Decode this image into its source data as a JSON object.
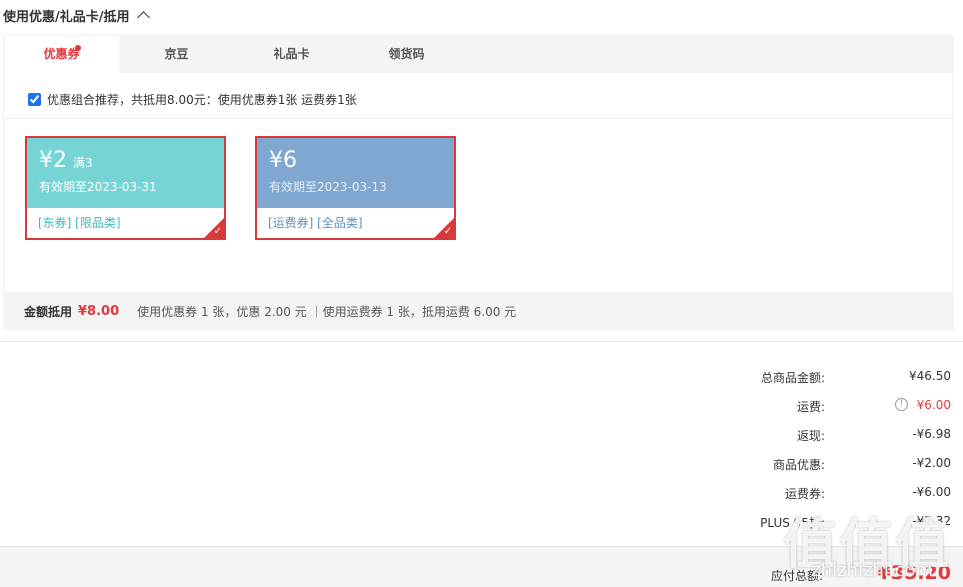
{
  "section": {
    "title": "使用优惠/礼品卡/抵用"
  },
  "tabs": [
    {
      "label": "优惠券",
      "active": true
    },
    {
      "label": "京豆"
    },
    {
      "label": "礼品卡"
    },
    {
      "label": "领货码"
    }
  ],
  "combo": {
    "text": "优惠组合推荐，共抵用8.00元：使用优惠券1张 运费券1张",
    "checked": true
  },
  "coupons": [
    {
      "amount": "¥2",
      "condition": "满3",
      "validity": "有效期至2023-03-31",
      "tags": "[东券]  [限品类]",
      "selected_mark": "✓"
    },
    {
      "amount": "¥6",
      "condition": "",
      "validity": "有效期至2023-03-13",
      "tags": "[运费券]  [全品类]",
      "selected_mark": "✓"
    }
  ],
  "summary": {
    "label": "金额抵用",
    "amount": "¥8.00",
    "detail": "使用优惠券 1 张，优惠 2.00 元 ｜使用运费券 1 张，抵用运费 6.00 元"
  },
  "totals": [
    {
      "label": "总商品金额:",
      "value": "¥46.50"
    },
    {
      "label": "运费:",
      "value": "¥6.00",
      "info_icon": "info-circle-icon"
    },
    {
      "label": "返现:",
      "value": "-¥6.98"
    },
    {
      "label": "商品优惠:",
      "value": "-¥2.00"
    },
    {
      "label": "运费券:",
      "value": "-¥6.00"
    },
    {
      "label": "PLUS 95折:",
      "value": "-¥2.32"
    }
  ],
  "footer": {
    "label": "应付总额:",
    "value": "¥35.20"
  },
  "watermark": {
    "glyphs": "值值值",
    "text": "zhizhizhi.com"
  },
  "colors": {
    "accent": "#e4393c",
    "coupon1": "#76d4d5",
    "coupon2": "#7fa7d0"
  }
}
